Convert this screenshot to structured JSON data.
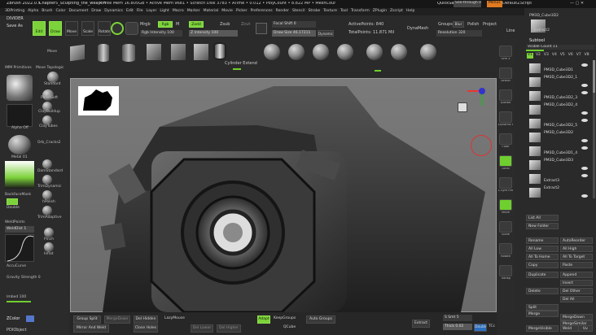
{
  "titlebar": {
    "app": "ZBrush 2022.0.5",
    "doc": "Chapter5_Sculpting_the_weapon",
    "stats": "• Free Mem 16.805GB • Active Mem 9681 • Scratch Disk 3783 • ATime • 0.012 • PolyCount • 8.822 MP • MeshCount • 25",
    "quicksave": "QuickSave",
    "seethrough": "See-through  0",
    "menus_btn": "Menus",
    "default_script": "DefaultZScript"
  },
  "menu_items": [
    "3DPrinting",
    "Alpha",
    "Brush",
    "Color",
    "Document",
    "Draw",
    "Dynamics",
    "Edit",
    "File",
    "Layer",
    "Light",
    "Macro",
    "Marker",
    "Material",
    "Movie",
    "Picker",
    "Preferences",
    "Render",
    "Stencil",
    "Stroke",
    "Texture",
    "Tool",
    "Transform",
    "ZPlugin",
    "Zscript",
    "Help"
  ],
  "divider": "DIVIDER",
  "save_as": "Save As",
  "top_toolbar": {
    "modes": [
      "Edit",
      "Draw",
      "Move",
      "Scale",
      "Rotate"
    ],
    "mrgb": "Mrgb",
    "rgb": "Rgb",
    "m": "M",
    "zadd": "Zadd",
    "zsub": "Zsub",
    "zcut": "Zcut",
    "rgb_intensity": "Rgb Intensity 100",
    "z_intensity": "Z Intensity 100",
    "focal_shift": "Focal Shift 0",
    "draw_size": "Draw Size 46.17211",
    "dynamic": "Dynamic",
    "active_points": "ActivePoints: 840",
    "total_points": "TotalPoints: 11.871 Mil",
    "dynamesh": "DynaMesh",
    "groups": "Groups",
    "blur": "Blur",
    "polish": "Polish",
    "project": "Project",
    "resolution": "Resolution 320",
    "line": "Line"
  },
  "brush_shelf": {
    "cylinder_label": "Cylinder Extend"
  },
  "left_panel": {
    "imm_primitives": "IMM Primitives",
    "move_topologic": "Move Topologic",
    "move": "Move",
    "standard": "Standard",
    "panelsoft": "PanelSoft",
    "claybuildup": "ClayBuildup",
    "claytubes": "ClayTubes",
    "orb_cracks": "Orb_Cracks2",
    "alpha_off": "Alpha Off",
    "metal": "Metal 01",
    "damstandard": "DamStandard",
    "trimdynamic": "TrimDynamic",
    "hpolish": "hPolish",
    "trimadaptive": "TrimAdaptive",
    "pinch": "Pinch",
    "inflat": "Inflat",
    "backface": "BackfaceMask",
    "double": "Double",
    "weld_points": "WeldPoints",
    "weld_dist": "WeldDist 1",
    "accucurve": "AccuCurve",
    "gravity": "Gravity Strength 0",
    "imbed": "Imbed 100",
    "zcolor": "ZColor",
    "pdi_object": "PDIObject"
  },
  "right_nav": {
    "items": [
      "SPix 3",
      "Actual",
      "AAHalf",
      "Dynamic Persp",
      "Floor",
      "Local",
      "L.Sym Frame",
      "Move",
      "Scale",
      "Rotate",
      "Transp"
    ]
  },
  "subtool": {
    "title": "Subtool",
    "visible_count": "Visible Count 11",
    "v_tabs": [
      "V1",
      "V2",
      "V3",
      "V4",
      "V5",
      "V6",
      "V7",
      "V8"
    ],
    "top_item": "PM3D_Cube3D2",
    "top_item2": "Extract2",
    "items": [
      "PM3D_Cube3D1",
      "PM3D_Cube3D2_1",
      "PM3D_Cube3D2_3",
      "PM3D_Cube3D2_4",
      "PM3D_Cube3D2_5",
      "PM3D_Cube3D2",
      "PM3D_Cube3D1_4",
      "PM3D_Cube3D3",
      "Extract3",
      "Extract2"
    ],
    "buttons": {
      "list_all": "List All",
      "new_folder": "New Folder",
      "rename": "Rename",
      "auto_reorder": "AutoReorder",
      "all_low": "All Low",
      "all_high": "All High",
      "all_to_home": "All To Home",
      "all_to_target": "All To Target",
      "copy": "Copy",
      "paste": "Paste",
      "duplicate": "Duplicate",
      "append": "Append",
      "insert": "Insert",
      "delete": "Delete",
      "del_other": "Del Other",
      "del_all": "Del All",
      "split": "Split",
      "merge": "Merge",
      "merge_down": "MergeDown",
      "merge_similar": "MergeSimilar",
      "merge_visible": "MergeVisible",
      "weld": "Weld",
      "uv": "Uv"
    }
  },
  "bottom_bar": {
    "group_split": "Group Split",
    "merge_down": "MergeDown",
    "del_hidden": "Del Hidden",
    "lazy_mouse": "LazyMouse",
    "mirror_weld": "Mirror And Weld",
    "close_holes": "Close Holes",
    "del_lower": "Del Lower",
    "del_higher": "Del Higher",
    "adapt": "Adapt",
    "keep_groups": "KeepGroups",
    "qcube": "QCube",
    "auto_groups": "Auto Groups",
    "extract": "Extract",
    "s_smt": "S Smt 5",
    "thick": "Thick 0.02",
    "double": "Double",
    "tcc": "TCc"
  }
}
